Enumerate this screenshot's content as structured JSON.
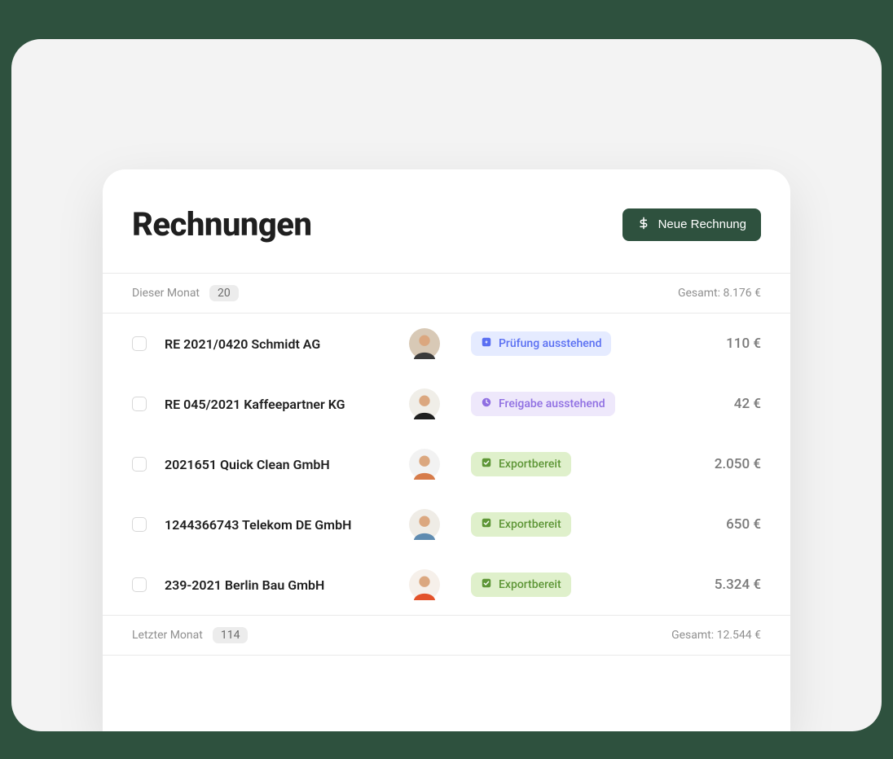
{
  "header": {
    "title": "Rechnungen",
    "new_button_label": "Neue Rechnung"
  },
  "sections": [
    {
      "label": "Dieser Monat",
      "count": "20",
      "total": "Gesamt: 8.176 €",
      "rows": [
        {
          "title": "RE 2021/0420 Schmidt AG",
          "status_key": "review",
          "status_label": "Prüfung ausstehend",
          "amount": "110 €",
          "avatar_bg": "#d8c9b6",
          "avatar_shirt": "#3a3a3a"
        },
        {
          "title": "RE 045/2021 Kaffeepartner KG",
          "status_key": "approval",
          "status_label": "Freigabe ausstehend",
          "amount": "42 €",
          "avatar_bg": "#f0eee8",
          "avatar_shirt": "#1f1f1f"
        },
        {
          "title": "2021651 Quick Clean GmbH",
          "status_key": "ready",
          "status_label": "Exportbereit",
          "amount": "2.050 €",
          "avatar_bg": "#f2f2f2",
          "avatar_shirt": "#d67b4a"
        },
        {
          "title": "1244366743 Telekom DE GmbH",
          "status_key": "ready",
          "status_label": "Exportbereit",
          "amount": "650 €",
          "avatar_bg": "#efece6",
          "avatar_shirt": "#5f8bb0"
        },
        {
          "title": "239-2021 Berlin Bau GmbH",
          "status_key": "ready",
          "status_label": "Exportbereit",
          "amount": "5.324 €",
          "avatar_bg": "#f6f0ea",
          "avatar_shirt": "#e3522a"
        }
      ]
    },
    {
      "label": "Letzter Monat",
      "count": "114",
      "total": "Gesamt: 12.544 €",
      "rows": []
    }
  ],
  "status_icons": {
    "review": "review-pending-icon",
    "approval": "approval-pending-icon",
    "ready": "export-ready-icon"
  }
}
